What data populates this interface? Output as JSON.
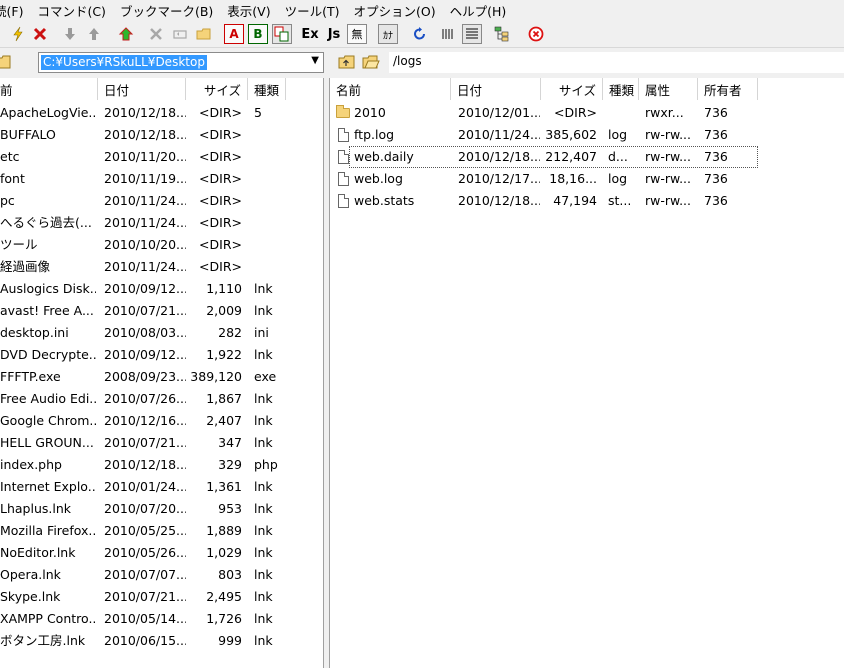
{
  "menu": [
    "続(F)",
    "コマンド(C)",
    "ブックマーク(B)",
    "表示(V)",
    "ツール(T)",
    "オプション(O)",
    "ヘルプ(H)"
  ],
  "toolbar": {
    "ex_label": "Ex",
    "js_label": "Js",
    "mu_label": "無",
    "ka_label": "ｶﾅ",
    "a_label": "A",
    "b_label": "B"
  },
  "local": {
    "path": "C:¥Users¥RSkuLL¥Desktop",
    "columns": [
      "前",
      "日付",
      "サイズ",
      "種類"
    ],
    "files": [
      {
        "name": "ApacheLogVie...",
        "date": "2010/12/18...",
        "size": "<DIR>",
        "type": "5"
      },
      {
        "name": "BUFFALO",
        "date": "2010/12/18...",
        "size": "<DIR>",
        "type": ""
      },
      {
        "name": "etc",
        "date": "2010/11/20...",
        "size": "<DIR>",
        "type": ""
      },
      {
        "name": "font",
        "date": "2010/11/19...",
        "size": "<DIR>",
        "type": ""
      },
      {
        "name": "pc",
        "date": "2010/11/24...",
        "size": "<DIR>",
        "type": ""
      },
      {
        "name": "へるぐら過去(...",
        "date": "2010/11/24...",
        "size": "<DIR>",
        "type": ""
      },
      {
        "name": "ツール",
        "date": "2010/10/20...",
        "size": "<DIR>",
        "type": ""
      },
      {
        "name": "経過画像",
        "date": "2010/11/24...",
        "size": "<DIR>",
        "type": ""
      },
      {
        "name": "Auslogics Disk...",
        "date": "2010/09/12...",
        "size": "1,110",
        "type": "lnk"
      },
      {
        "name": "avast! Free A...",
        "date": "2010/07/21...",
        "size": "2,009",
        "type": "lnk"
      },
      {
        "name": "desktop.ini",
        "date": "2010/08/03...",
        "size": "282",
        "type": "ini"
      },
      {
        "name": "DVD Decrypte...",
        "date": "2010/09/12...",
        "size": "1,922",
        "type": "lnk"
      },
      {
        "name": "FFFTP.exe",
        "date": "2008/09/23...",
        "size": "389,120",
        "type": "exe"
      },
      {
        "name": "Free Audio Edi...",
        "date": "2010/07/26...",
        "size": "1,867",
        "type": "lnk"
      },
      {
        "name": "Google Chrom...",
        "date": "2010/12/16...",
        "size": "2,407",
        "type": "lnk"
      },
      {
        "name": "HELL GROUN...",
        "date": "2010/07/21...",
        "size": "347",
        "type": "lnk"
      },
      {
        "name": "index.php",
        "date": "2010/12/18...",
        "size": "329",
        "type": "php"
      },
      {
        "name": "Internet Explo...",
        "date": "2010/01/24...",
        "size": "1,361",
        "type": "lnk"
      },
      {
        "name": "Lhaplus.lnk",
        "date": "2010/07/20...",
        "size": "953",
        "type": "lnk"
      },
      {
        "name": "Mozilla Firefox...",
        "date": "2010/05/25...",
        "size": "1,889",
        "type": "lnk"
      },
      {
        "name": "NoEditor.lnk",
        "date": "2010/05/26...",
        "size": "1,029",
        "type": "lnk"
      },
      {
        "name": "Opera.lnk",
        "date": "2010/07/07...",
        "size": "803",
        "type": "lnk"
      },
      {
        "name": "Skype.lnk",
        "date": "2010/07/21...",
        "size": "2,495",
        "type": "lnk"
      },
      {
        "name": "XAMPP Contro...",
        "date": "2010/05/14...",
        "size": "1,726",
        "type": "lnk"
      },
      {
        "name": "ボタン工房.lnk",
        "date": "2010/06/15...",
        "size": "999",
        "type": "lnk"
      }
    ]
  },
  "remote": {
    "path": "/logs",
    "columns": [
      "名前",
      "日付",
      "サイズ",
      "種類",
      "属性",
      "所有者"
    ],
    "files": [
      {
        "name": "2010",
        "date": "2010/12/01...",
        "size": "<DIR>",
        "type": "",
        "attr": "rwxr...",
        "owner": "736",
        "kind": "folder"
      },
      {
        "name": "ftp.log",
        "date": "2010/11/24...",
        "size": "385,602",
        "type": "log",
        "attr": "rw-rw...",
        "owner": "736",
        "kind": "file"
      },
      {
        "name": "web.daily",
        "date": "2010/12/18...",
        "size": "212,407",
        "type": "d...",
        "attr": "rw-rw...",
        "owner": "736",
        "kind": "file"
      },
      {
        "name": "web.log",
        "date": "2010/12/17...",
        "size": "18,16...",
        "type": "log",
        "attr": "rw-rw...",
        "owner": "736",
        "kind": "file"
      },
      {
        "name": "web.stats",
        "date": "2010/12/18...",
        "size": "47,194",
        "type": "st...",
        "attr": "rw-rw...",
        "owner": "736",
        "kind": "file"
      }
    ],
    "focused_index": 2
  },
  "colors": {
    "selection": "#3399ff",
    "path_text": "#ffffff"
  }
}
